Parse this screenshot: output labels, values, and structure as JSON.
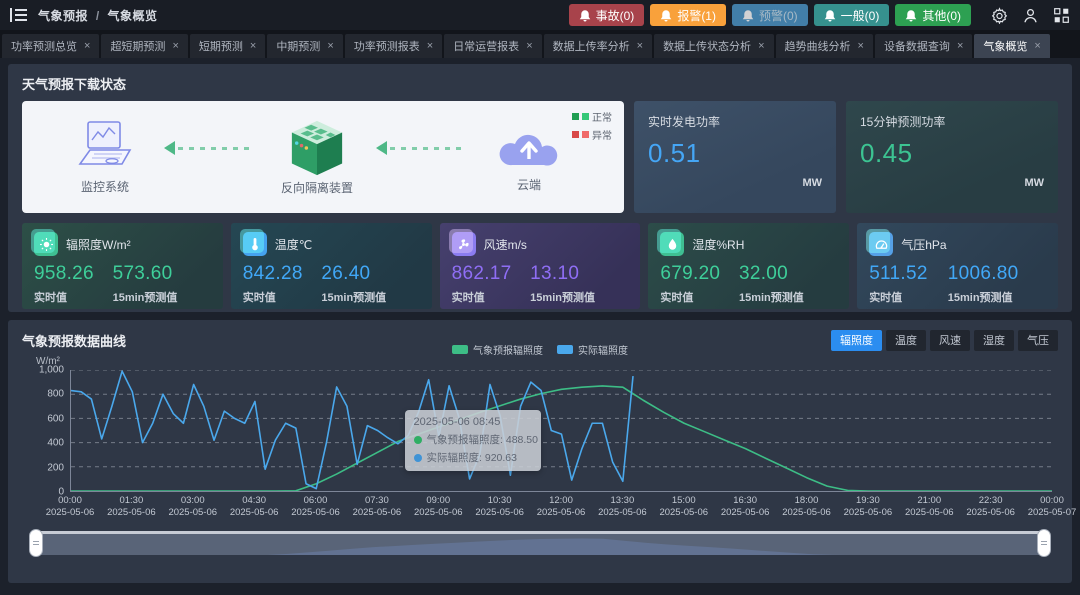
{
  "header": {
    "breadcrumb": {
      "section": "气象预报",
      "separator": "/",
      "page": "气象概览"
    },
    "alerts": [
      {
        "label": "事故(0)",
        "color": "#a8434b"
      },
      {
        "label": "报警(1)",
        "color": "#f9a13b"
      },
      {
        "label": "预警(0)",
        "color": "#4d97c9"
      },
      {
        "label": "一般(0)",
        "color": "#36918e"
      },
      {
        "label": "其他(0)",
        "color": "#2da052"
      }
    ]
  },
  "tabs": [
    {
      "label": "功率预测总览",
      "active": false
    },
    {
      "label": "超短期预测",
      "active": false
    },
    {
      "label": "短期预测",
      "active": false
    },
    {
      "label": "中期预测",
      "active": false
    },
    {
      "label": "功率预测报表",
      "active": false
    },
    {
      "label": "日常运营报表",
      "active": false
    },
    {
      "label": "数据上传率分析",
      "active": false
    },
    {
      "label": "数据上传状态分析",
      "active": false
    },
    {
      "label": "趋势曲线分析",
      "active": false
    },
    {
      "label": "设备数据查询",
      "active": false
    },
    {
      "label": "气象概览",
      "active": true
    }
  ],
  "download_status": {
    "title": "天气预报下载状态",
    "nodes": [
      {
        "label": "监控系统",
        "icon": "monitor-laptop-icon"
      },
      {
        "label": "反向隔离装置",
        "icon": "isolation-device-icon"
      },
      {
        "label": "云端",
        "icon": "cloud-upload-icon"
      }
    ],
    "legend": [
      {
        "label": "正常",
        "color": "#2fae64"
      },
      {
        "label": "异常",
        "color": "#e05252"
      }
    ]
  },
  "power_panels": [
    {
      "title": "实时发电功率",
      "value": "0.51",
      "unit": "MW",
      "value_color": "#45a6f5"
    },
    {
      "title": "15分钟预测功率",
      "value": "0.45",
      "unit": "MW",
      "value_color": "#3cc492"
    }
  ],
  "metric_cards": [
    {
      "title": "辐照度W/m²",
      "icon": "sun-icon",
      "accent": "#3ecf9a",
      "realtime_value": "958.26",
      "realtime_label": "实时值",
      "forecast_value": "573.60",
      "forecast_label": "15min预测值"
    },
    {
      "title": "温度℃",
      "icon": "thermometer-icon",
      "accent": "#41a8f7",
      "realtime_value": "842.28",
      "realtime_label": "实时值",
      "forecast_value": "26.40",
      "forecast_label": "15min预测值"
    },
    {
      "title": "风速m/s",
      "icon": "wind-fan-icon",
      "accent": "#8f6ef5",
      "realtime_value": "862.17",
      "realtime_label": "实时值",
      "forecast_value": "13.10",
      "forecast_label": "15min预测值"
    },
    {
      "title": "湿度%RH",
      "icon": "humidity-icon",
      "accent": "#3ecf9a",
      "realtime_value": "679.20",
      "realtime_label": "实时值",
      "forecast_value": "32.00",
      "forecast_label": "15min预测值"
    },
    {
      "title": "气压hPa",
      "icon": "pressure-gauge-icon",
      "accent": "#41a8f7",
      "realtime_value": "511.52",
      "realtime_label": "实时值",
      "forecast_value": "1006.80",
      "forecast_label": "15min预测值"
    }
  ],
  "chart": {
    "title": "气象预报数据曲线",
    "unit_buttons": [
      {
        "label": "辐照度",
        "active": true
      },
      {
        "label": "温度",
        "active": false
      },
      {
        "label": "风速",
        "active": false
      },
      {
        "label": "湿度",
        "active": false
      },
      {
        "label": "气压",
        "active": false
      }
    ],
    "tooltip": {
      "time": "2025-05-06 08:45",
      "rows": [
        {
          "name": "气象预报辐照度",
          "value": "488.50",
          "color": "#2fae64"
        },
        {
          "name": "实际辐照度",
          "value": "920.63",
          "color": "#3f93d6"
        }
      ]
    }
  },
  "chart_data": {
    "type": "line",
    "title": "气象预报数据曲线",
    "ylabel": "W/m²",
    "ylim": [
      0,
      1000
    ],
    "yticks": [
      {
        "v": 0,
        "label": "0"
      },
      {
        "v": 200,
        "label": "200"
      },
      {
        "v": 400,
        "label": "400"
      },
      {
        "v": 600,
        "label": "600"
      },
      {
        "v": 800,
        "label": "800"
      },
      {
        "v": 1000,
        "label": "1,000"
      }
    ],
    "x_range_hours": [
      0,
      24
    ],
    "grid": "dashed-horizontal",
    "legend_position": "top-center",
    "x_ticks": [
      {
        "time": "00:00",
        "date": "2025-05-06"
      },
      {
        "time": "01:30",
        "date": "2025-05-06"
      },
      {
        "time": "03:00",
        "date": "2025-05-06"
      },
      {
        "time": "04:30",
        "date": "2025-05-06"
      },
      {
        "time": "06:00",
        "date": "2025-05-06"
      },
      {
        "time": "07:30",
        "date": "2025-05-06"
      },
      {
        "time": "09:00",
        "date": "2025-05-06"
      },
      {
        "time": "10:30",
        "date": "2025-05-06"
      },
      {
        "time": "12:00",
        "date": "2025-05-06"
      },
      {
        "time": "13:30",
        "date": "2025-05-06"
      },
      {
        "time": "15:00",
        "date": "2025-05-06"
      },
      {
        "time": "16:30",
        "date": "2025-05-06"
      },
      {
        "time": "18:00",
        "date": "2025-05-06"
      },
      {
        "time": "19:30",
        "date": "2025-05-06"
      },
      {
        "time": "21:00",
        "date": "2025-05-06"
      },
      {
        "time": "22:30",
        "date": "2025-05-06"
      },
      {
        "time": "00:00",
        "date": "2025-05-07"
      }
    ],
    "series": [
      {
        "name": "气象预报辐照度",
        "color": "#3dbd86",
        "x_start_hour": 0,
        "x_step_hours": 0.5,
        "values": [
          0,
          0,
          0,
          0,
          0,
          0,
          0,
          0,
          0,
          0,
          0,
          2,
          60,
          140,
          230,
          320,
          410,
          470,
          530,
          590,
          650,
          705,
          760,
          805,
          840,
          858,
          868,
          858,
          750,
          650,
          560,
          490,
          420,
          350,
          270,
          190,
          110,
          40,
          5,
          0,
          0,
          0,
          0,
          0,
          0,
          0,
          0,
          0,
          0
        ]
      },
      {
        "name": "实际辐照度",
        "color": "#4aa8ec",
        "x_start_hour": 0,
        "x_step_hours": 0.25,
        "values": [
          830,
          820,
          760,
          430,
          700,
          990,
          820,
          400,
          560,
          800,
          640,
          560,
          880,
          700,
          420,
          660,
          600,
          560,
          740,
          180,
          420,
          560,
          520,
          60,
          20,
          400,
          860,
          700,
          220,
          540,
          500,
          440,
          390,
          460,
          650,
          920,
          450,
          870,
          600,
          100,
          300,
          880,
          620,
          130,
          700,
          900,
          830,
          500,
          470,
          90,
          350,
          560,
          560,
          240,
          80,
          950
        ]
      }
    ]
  }
}
